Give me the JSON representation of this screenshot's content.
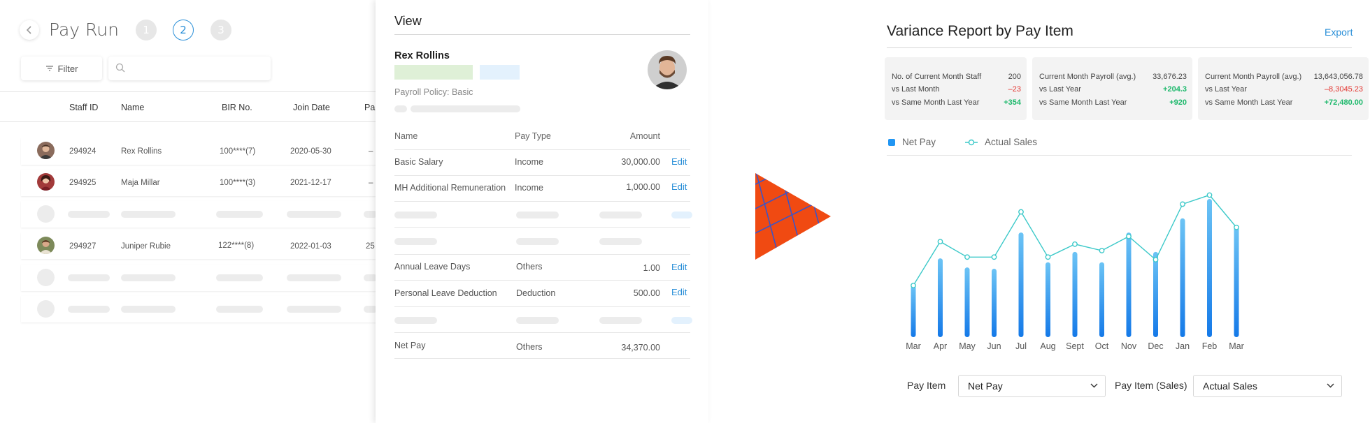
{
  "payrun": {
    "title": "Pay Run",
    "steps": [
      "1",
      "2",
      "3"
    ],
    "filter_label": "Filter",
    "search_placeholder": "",
    "columns": [
      "Staff ID",
      "Name",
      "BIR No.",
      "Join Date",
      "Pa"
    ],
    "rows": [
      {
        "staff_id": "294924",
        "name": "Rex Rollins",
        "bir": "100****(7)",
        "join": "2020-05-30",
        "extra": "–"
      },
      {
        "staff_id": "294925",
        "name": "Maja Millar",
        "bir": "100****(3)",
        "join": "2021-12-17",
        "extra": "–"
      },
      {
        "staff_id": "294927",
        "name": "Juniper Rubie",
        "bir": "122****(8)",
        "join": "2022-01-03",
        "extra": "25"
      }
    ]
  },
  "view": {
    "title": "View",
    "person_name": "Rex Rollins",
    "policy": "Payroll Policy: Basic",
    "columns": [
      "Name",
      "Pay Type",
      "Amount"
    ],
    "items": [
      {
        "name": "Basic Salary",
        "type": "Income",
        "amount": "30,000.00",
        "action": "Edit"
      },
      {
        "name": "MH Additional Remuneration",
        "type": "Income",
        "amount": "1,000.00",
        "action": "Edit"
      },
      {
        "name": "Annual Leave Days",
        "type": "Others",
        "amount": "1.00",
        "action": "Edit"
      },
      {
        "name": "Personal Leave Deduction",
        "type": "Deduction",
        "amount": "500.00",
        "action": "Edit"
      },
      {
        "name": "Net Pay",
        "type": "Others",
        "amount": "34,370.00",
        "action": ""
      }
    ]
  },
  "report": {
    "title": "Variance Report by Pay Item",
    "export_label": "Export",
    "cards": [
      {
        "rows": [
          {
            "label": "No. of Current Month Staff",
            "value": "200",
            "tone": "plain"
          },
          {
            "label": "vs Last Month",
            "value": "–23",
            "tone": "neg"
          },
          {
            "label": "vs Same Month Last Year",
            "value": "+354",
            "tone": "pos"
          }
        ]
      },
      {
        "rows": [
          {
            "label": "Current Month Payroll (avg.)",
            "value": "33,676.23",
            "tone": "plain"
          },
          {
            "label": "vs Last Year",
            "value": "+204.3",
            "tone": "pos"
          },
          {
            "label": "vs Same Month Last Year",
            "value": "+920",
            "tone": "pos"
          }
        ]
      },
      {
        "rows": [
          {
            "label": "Current Month Payroll (avg.)",
            "value": "13,643,056.78",
            "tone": "plain"
          },
          {
            "label": "vs Last Year",
            "value": "–8,3045.23",
            "tone": "neg"
          },
          {
            "label": "vs Same Month Last Year",
            "value": "+72,480.00",
            "tone": "pos"
          }
        ]
      }
    ],
    "legend": {
      "bar": "Net Pay",
      "line": "Actual Sales"
    },
    "pay_item_label": "Pay Item",
    "pay_item_value": "Net Pay",
    "pay_item_sales_label": "Pay Item (Sales)",
    "pay_item_sales_value": "Actual Sales"
  },
  "colors": {
    "accent": "#2a8fd8",
    "bar": "#2196f3",
    "line": "#3cc9c9",
    "arrow": "#f04a12",
    "negative": "#e3342f",
    "positive": "#1cb86b"
  },
  "chart_data": {
    "type": "bar",
    "categories": [
      "Mar",
      "Apr",
      "May",
      "Jun",
      "Jul",
      "Aug",
      "Sept",
      "Oct",
      "Nov",
      "Dec",
      "Jan",
      "Feb",
      "Mar"
    ],
    "series": [
      {
        "name": "Net Pay",
        "type": "bar",
        "values": [
          40,
          61,
          54,
          53,
          81,
          58,
          66,
          58,
          81,
          66,
          92,
          107,
          86
        ]
      },
      {
        "name": "Actual Sales",
        "type": "line",
        "values": [
          40,
          74,
          62,
          62,
          97,
          62,
          72,
          67,
          78,
          60,
          103,
          110,
          85
        ]
      }
    ],
    "title": "Variance Report by Pay Item",
    "legend": "top-left",
    "grid": false
  }
}
